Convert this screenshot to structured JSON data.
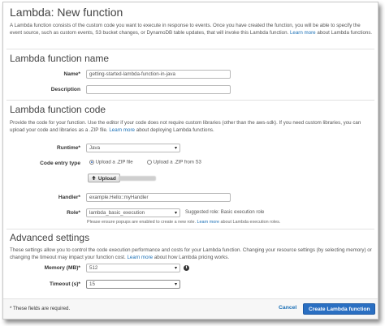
{
  "header": {
    "title": "Lambda: New function",
    "description": "A Lambda function consists of the custom code you want to execute in response to events. Once you have created the function, you will be able to specify the event source, such as custom events, S3 bucket changes, or DynamoDB table updates, that will invoke this Lambda function.",
    "learn_more": "Learn more",
    "learn_more_suffix": "about Lambda functions."
  },
  "function_name_section": {
    "title": "Lambda function name",
    "name_label": "Name*",
    "name_value": "getting-started-lambda-function-in-java",
    "description_label": "Description",
    "description_value": ""
  },
  "code_section": {
    "title": "Lambda function code",
    "description": "Provide the code for your function. Use the editor if your code does not require custom libraries (other than the aws-sdk). If you need custom libraries, you can upload your code and libraries as a .ZIP file.",
    "learn_more": "Learn more",
    "learn_more_suffix": "about deploying Lambda functions.",
    "runtime_label": "Runtime*",
    "runtime_value": "Java",
    "entry_type_label": "Code entry type",
    "option_upload_zip": "Upload a .ZIP file",
    "option_upload_s3": "Upload a .ZIP from S3",
    "upload_button": "Upload",
    "handler_label": "Handler*",
    "handler_value": "example.Hello::myHandler",
    "role_label": "Role*",
    "role_value": "lambda_basic_execution",
    "suggested_role": "Suggested role:  Basic execution role",
    "popup_note": "Please ensure popups are enabled to create a new role.",
    "popup_learn_more": "Learn more",
    "popup_suffix": "about Lambda execution roles."
  },
  "advanced_section": {
    "title": "Advanced settings",
    "description": "These settings allow you to control the code execution performance and costs for your Lambda function. Changing your resource settings (by selecting memory) or changing the timeout may impact your function cost.",
    "learn_more": "Learn more",
    "learn_more_suffix": "about how Lambda pricing works.",
    "memory_label": "Memory (MB)*",
    "memory_value": "512",
    "timeout_label": "Timeout (s)*",
    "timeout_value": "15"
  },
  "footer": {
    "required_note": "* These fields are required.",
    "cancel": "Cancel",
    "create": "Create Lambda function"
  },
  "icons": {
    "caret": "▾",
    "info": "i",
    "upload": "upload-icon"
  },
  "colors": {
    "link": "#1a6fb5",
    "primary": "#2a6fc2"
  }
}
